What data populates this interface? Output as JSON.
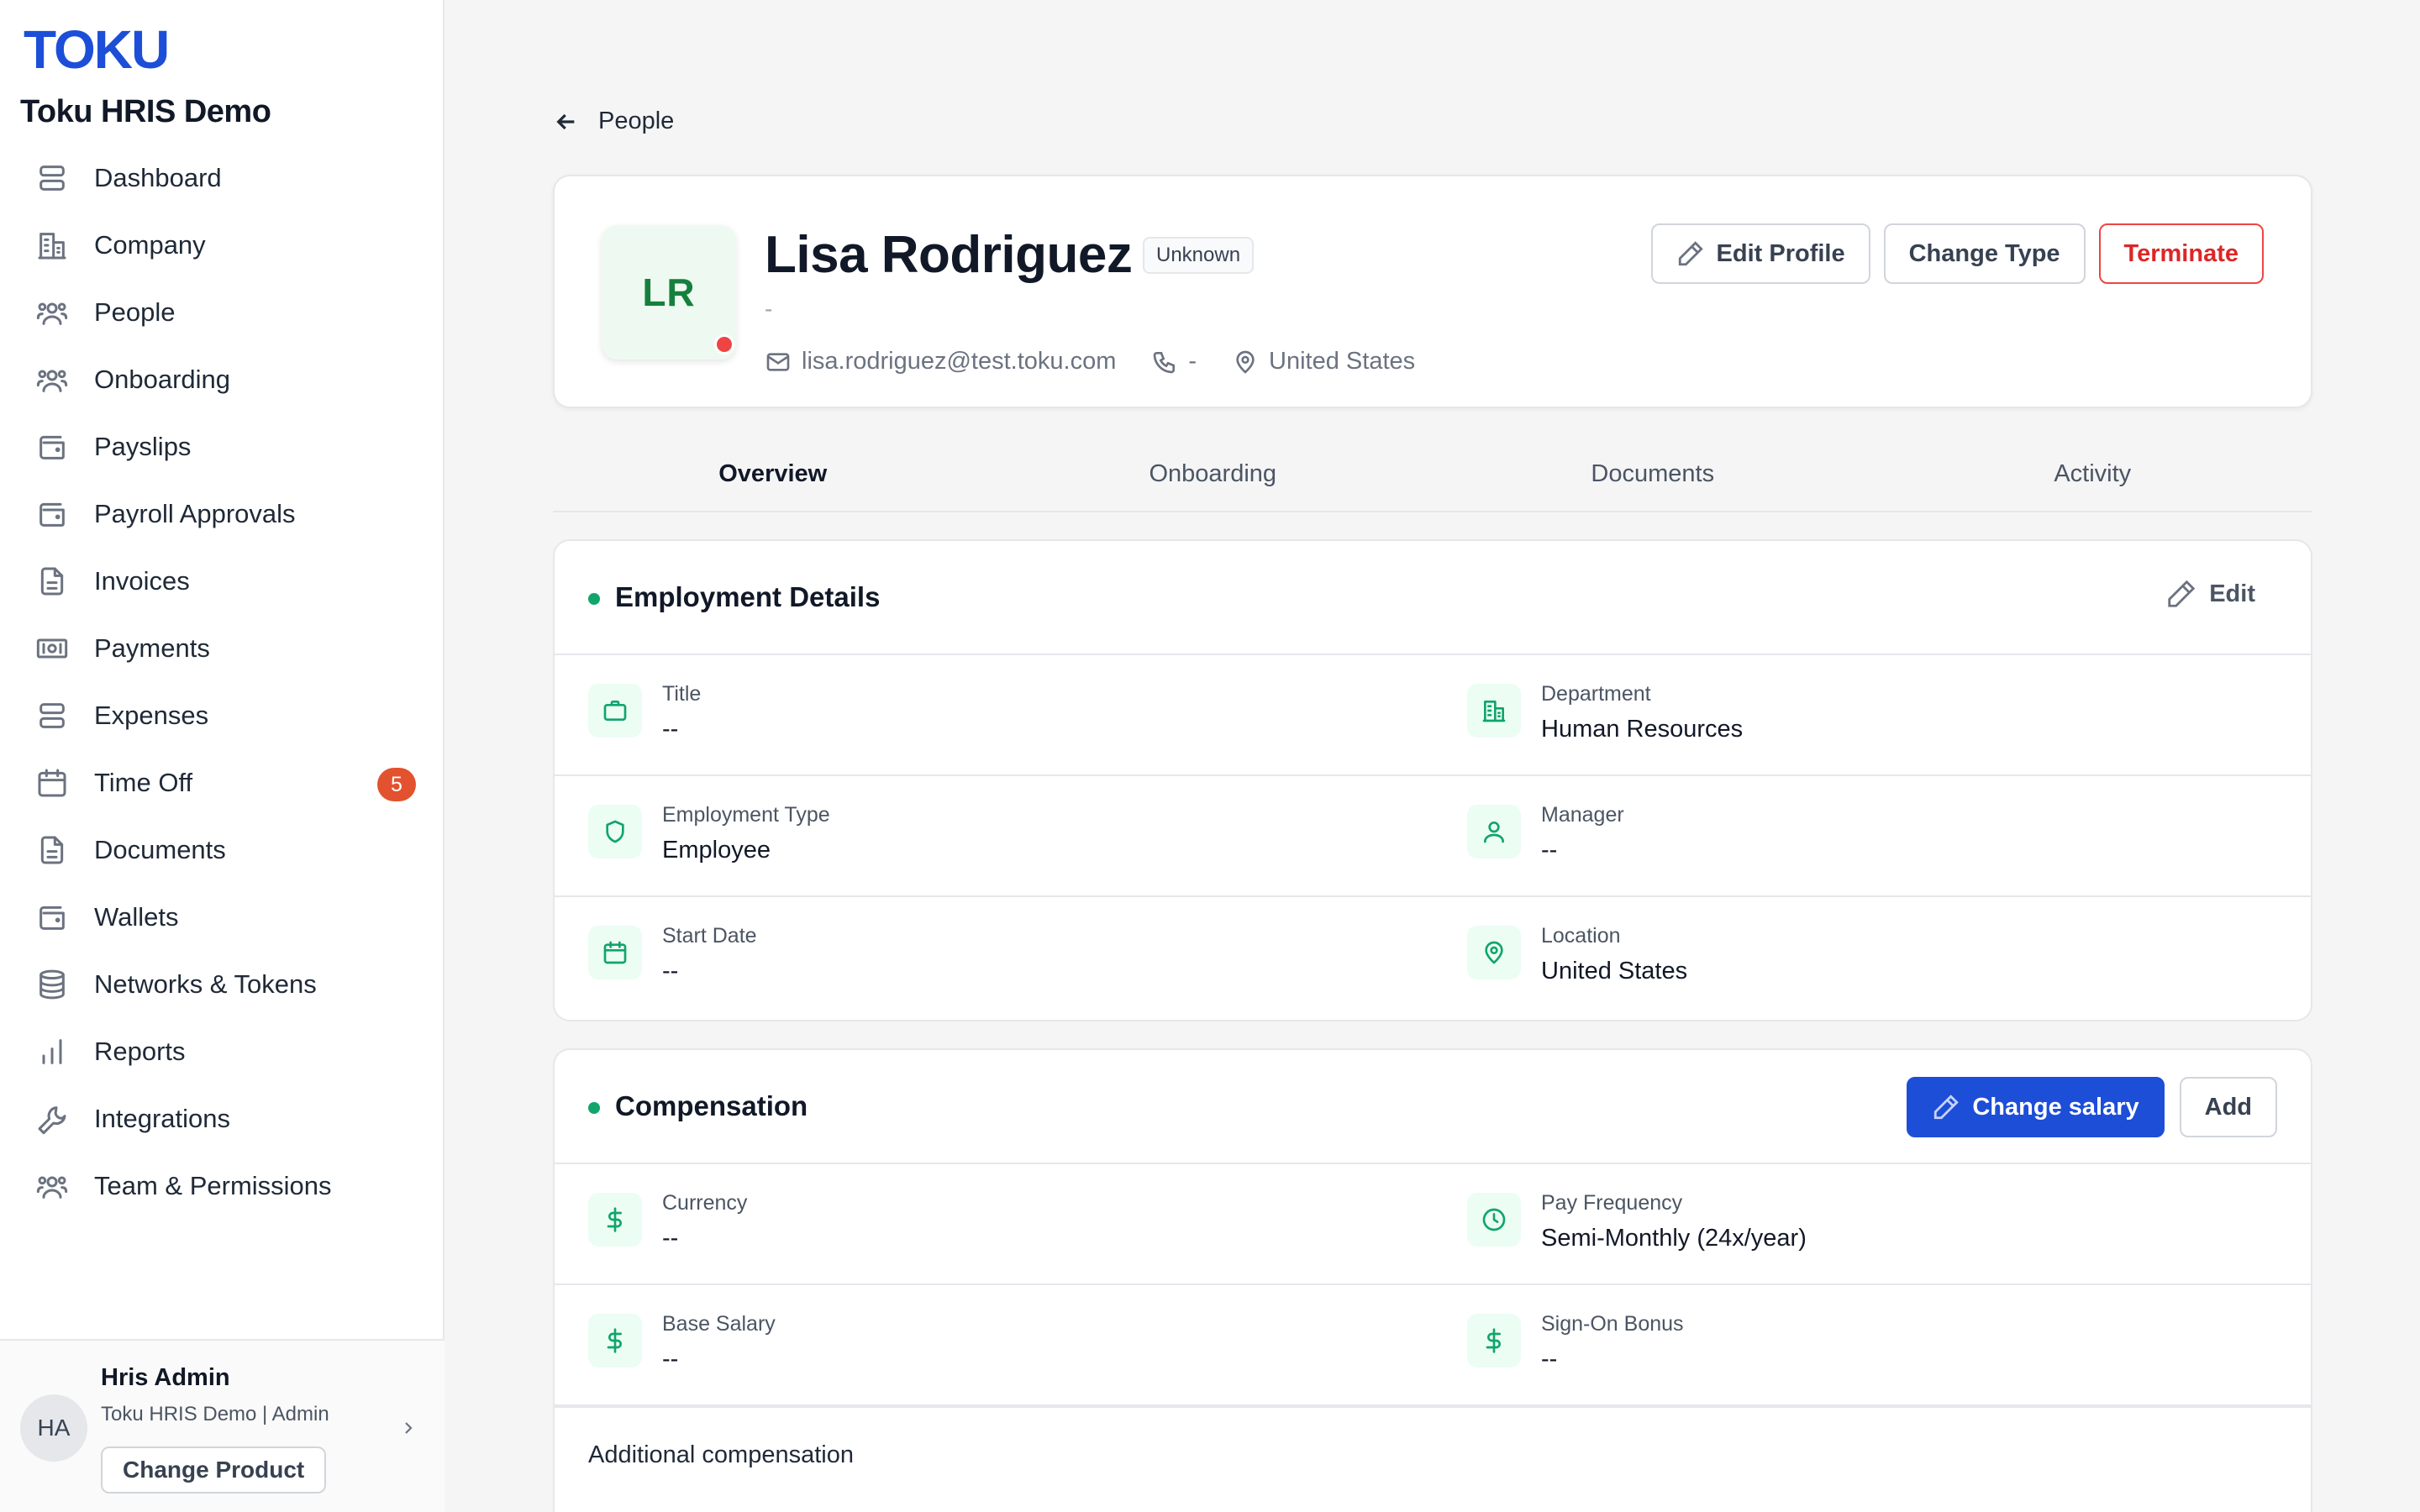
{
  "brand": {
    "logo": "TOKU",
    "org": "Toku HRIS Demo"
  },
  "sidebar": {
    "items": [
      {
        "label": "Dashboard",
        "icon": "dashboard-icon"
      },
      {
        "label": "Company",
        "icon": "building-icon"
      },
      {
        "label": "People",
        "icon": "users-icon"
      },
      {
        "label": "Onboarding",
        "icon": "users-icon"
      },
      {
        "label": "Payslips",
        "icon": "wallet-icon"
      },
      {
        "label": "Payroll Approvals",
        "icon": "wallet-icon"
      },
      {
        "label": "Invoices",
        "icon": "document-icon"
      },
      {
        "label": "Payments",
        "icon": "banknote-icon"
      },
      {
        "label": "Expenses",
        "icon": "server-icon"
      },
      {
        "label": "Time Off",
        "icon": "calendar-icon",
        "badge": "5"
      },
      {
        "label": "Documents",
        "icon": "document-icon"
      },
      {
        "label": "Wallets",
        "icon": "wallet-icon"
      },
      {
        "label": "Networks & Tokens",
        "icon": "database-icon"
      },
      {
        "label": "Reports",
        "icon": "bar-chart-icon"
      },
      {
        "label": "Integrations",
        "icon": "wrench-icon"
      },
      {
        "label": "Team & Permissions",
        "icon": "users-icon"
      }
    ]
  },
  "user": {
    "initials": "HA",
    "name": "Hris Admin",
    "subtitle": "Toku HRIS Demo | Admin",
    "change_product": "Change Product"
  },
  "back": {
    "label": "People"
  },
  "profile": {
    "initials": "LR",
    "name": "Lisa Rodriguez",
    "badge": "Unknown",
    "subtitle": "-",
    "email": "lisa.rodriguez@test.toku.com",
    "phone": "-",
    "location": "United States",
    "status_color": "#ef4444",
    "buttons": {
      "edit_profile": "Edit Profile",
      "change_type": "Change Type",
      "terminate": "Terminate"
    }
  },
  "tabs": [
    {
      "label": "Overview",
      "active": true
    },
    {
      "label": "Onboarding",
      "active": false
    },
    {
      "label": "Documents",
      "active": false
    },
    {
      "label": "Activity",
      "active": false
    }
  ],
  "employment": {
    "title": "Employment Details",
    "edit_label": "Edit",
    "fields": {
      "title": {
        "label": "Title",
        "value": "--"
      },
      "department": {
        "label": "Department",
        "value": "Human Resources"
      },
      "employment_type": {
        "label": "Employment Type",
        "value": "Employee"
      },
      "manager": {
        "label": "Manager",
        "value": "--"
      },
      "start_date": {
        "label": "Start Date",
        "value": "--"
      },
      "location": {
        "label": "Location",
        "value": "United States"
      }
    }
  },
  "compensation": {
    "title": "Compensation",
    "change_salary_label": "Change salary",
    "add_label": "Add",
    "fields": {
      "currency": {
        "label": "Currency",
        "value": "--"
      },
      "pay_frequency": {
        "label": "Pay Frequency",
        "value": "Semi-Monthly (24x/year)"
      },
      "base_salary": {
        "label": "Base Salary",
        "value": "--"
      },
      "sign_on_bonus": {
        "label": "Sign-On Bonus",
        "value": "--"
      }
    },
    "additional_title": "Additional compensation"
  },
  "colors": {
    "brand": "#1d4ed8",
    "accent_green": "#10a56b",
    "danger": "#dc2626",
    "badge_orange": "#e2522f"
  }
}
